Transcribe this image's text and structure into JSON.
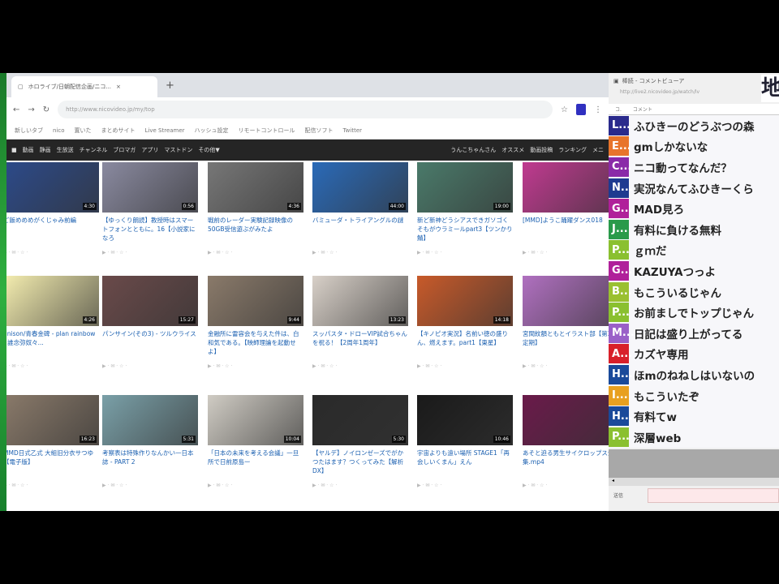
{
  "browser": {
    "tab_title": "ホロライブ/日朝配信企画/ニコ...",
    "url": "http://www.nicovideo.jp/my/top",
    "bookmarks": [
      "新しいタブ",
      "nico",
      "置いた",
      "まとめサイト",
      "Live Streamer",
      "ハッシュ設定",
      "リモートコントロール",
      "配信ソフト",
      "Twitter"
    ]
  },
  "nav": {
    "items": [
      "動画",
      "静画",
      "生放送",
      "チャンネル",
      "ブロマガ",
      "アプリ",
      "マストドン",
      "その他▼"
    ],
    "user": "うんこちゃんさん",
    "right": [
      "オススメ",
      "動画投稿",
      "ランキング",
      "メニ"
    ]
  },
  "videos": [
    {
      "title": "ご飯めめめがくじゃみ前編",
      "duration": "4:30",
      "color": "#2c4a8a"
    },
    {
      "title": "【ゆっくり朗読】教授時はスマートフォンとともに。16【小説家になろ",
      "duration": "0:56",
      "color": "#8a8aa0"
    },
    {
      "title": "戦前のレーダー実験記録映像の50GB受信遊ぶがみたよ",
      "duration": "4:36",
      "color": "#777"
    },
    {
      "title": "バミューダ・トライアングルの謎",
      "duration": "44:00",
      "color": "#2a6ab8"
    },
    {
      "title": "新ど新神どうシアスできガソゴくそもがウラミールpart3【ツンかり鯖】",
      "duration": "19:00",
      "color": "#4a7a6a"
    },
    {
      "title": "[MMD]ようこ踊躍ダンス018",
      "duration": "",
      "color": "#c03a90"
    },
    {
      "title": "unison/青春金碑 - plan rainbow - 誰念弥奴々...",
      "duration": "4:26",
      "color": "#f5eeb0"
    },
    {
      "title": "パンサイン(その3) - ツルウライス",
      "duration": "15:27",
      "color": "#6a4a4a"
    },
    {
      "title": "金融所に雷容会を与えた件は、白和気である。【映師理論を起動せよ】",
      "duration": "9:44",
      "color": "#8a7a6a"
    },
    {
      "title": "スッパスタ・ドローVIP試合ちゃんを祝る！【2周年1周年】",
      "duration": "13:23",
      "color": "#d8d0c8"
    },
    {
      "title": "【キノピオ実況】名前い徳の盛りん、燃えます。part1【東星】",
      "duration": "14:18",
      "color": "#c85a2a"
    },
    {
      "title": "宮間紋額ともとイラスト部【第3章定期】",
      "duration": "",
      "color": "#b070c0"
    },
    {
      "title": "MMD日式乙式 大組旧分衣サつゆ【電子版】",
      "duration": "16:23",
      "color": "#8a7a6a"
    },
    {
      "title": "考察表は特殊作りなんかい一日本誌 - PART 2",
      "duration": "5:31",
      "color": "#7aa0a8"
    },
    {
      "title": "「日本の未来を考える会議」一旦所で日前原島ー",
      "duration": "10:04",
      "color": "#d0ccc4"
    },
    {
      "title": "【ヤルデ】ノイロンゼーズでがかつたはます？つくってみた【解析DX】",
      "duration": "5:30",
      "color": "#2a2a2a"
    },
    {
      "title": "宇宙よりも遠い場所 STAGE1「再会しいくまん」えん",
      "duration": "10:46",
      "color": "#1a1a1a"
    },
    {
      "title": "あそと迫る男生サイクロップス全集.mp4",
      "duration": "",
      "color": "#6a1a4a"
    }
  ],
  "chat": {
    "window_title": "棒読 - コメントビューア",
    "url": "http://live2.nicovideo.jp/watch/lv",
    "logo": "地",
    "col_user": "コ.",
    "col_comment": "コメント",
    "comments": [
      {
        "user": "L...",
        "color": "#2a2a8c",
        "text": "ふひきーのどうぶつの森"
      },
      {
        "user": "E...",
        "color": "#e8742a",
        "text": "gmしかないな"
      },
      {
        "user": "C...",
        "color": "#8a2aa8",
        "text": "ニコ動ってなんだ？"
      },
      {
        "user": "N...",
        "color": "#1e3a90",
        "text": "実況なんてふひきーくら"
      },
      {
        "user": "G...",
        "color": "#b0209a",
        "text": "MAD見ろ"
      },
      {
        "user": "J...",
        "color": "#2a9a4a",
        "text": "有料に負ける無料"
      },
      {
        "user": "P...",
        "color": "#8ac030",
        "text": "ｇｍだ"
      },
      {
        "user": "G...",
        "color": "#b0209a",
        "text": "KAZUYAつっよ"
      },
      {
        "user": "B...",
        "color": "#9ac030",
        "text": "もこういるじゃん"
      },
      {
        "user": "P...",
        "color": "#8ac030",
        "text": "お前ましでトップじゃん"
      },
      {
        "user": "M...",
        "color": "#9a60c8",
        "text": "日記は盛り上がってる"
      },
      {
        "user": "A...",
        "color": "#d8202a",
        "text": "カズヤ専用"
      },
      {
        "user": "H...",
        "color": "#1a4a9a",
        "text": "ほmのねねしはいないの"
      },
      {
        "user": "I...",
        "color": "#e8a020",
        "text": "もこういたぞ"
      },
      {
        "user": "H...",
        "color": "#1a4a9a",
        "text": "有料てw"
      },
      {
        "user": "P...",
        "color": "#8ac030",
        "text": "深層web"
      }
    ],
    "input_label": "送信"
  }
}
